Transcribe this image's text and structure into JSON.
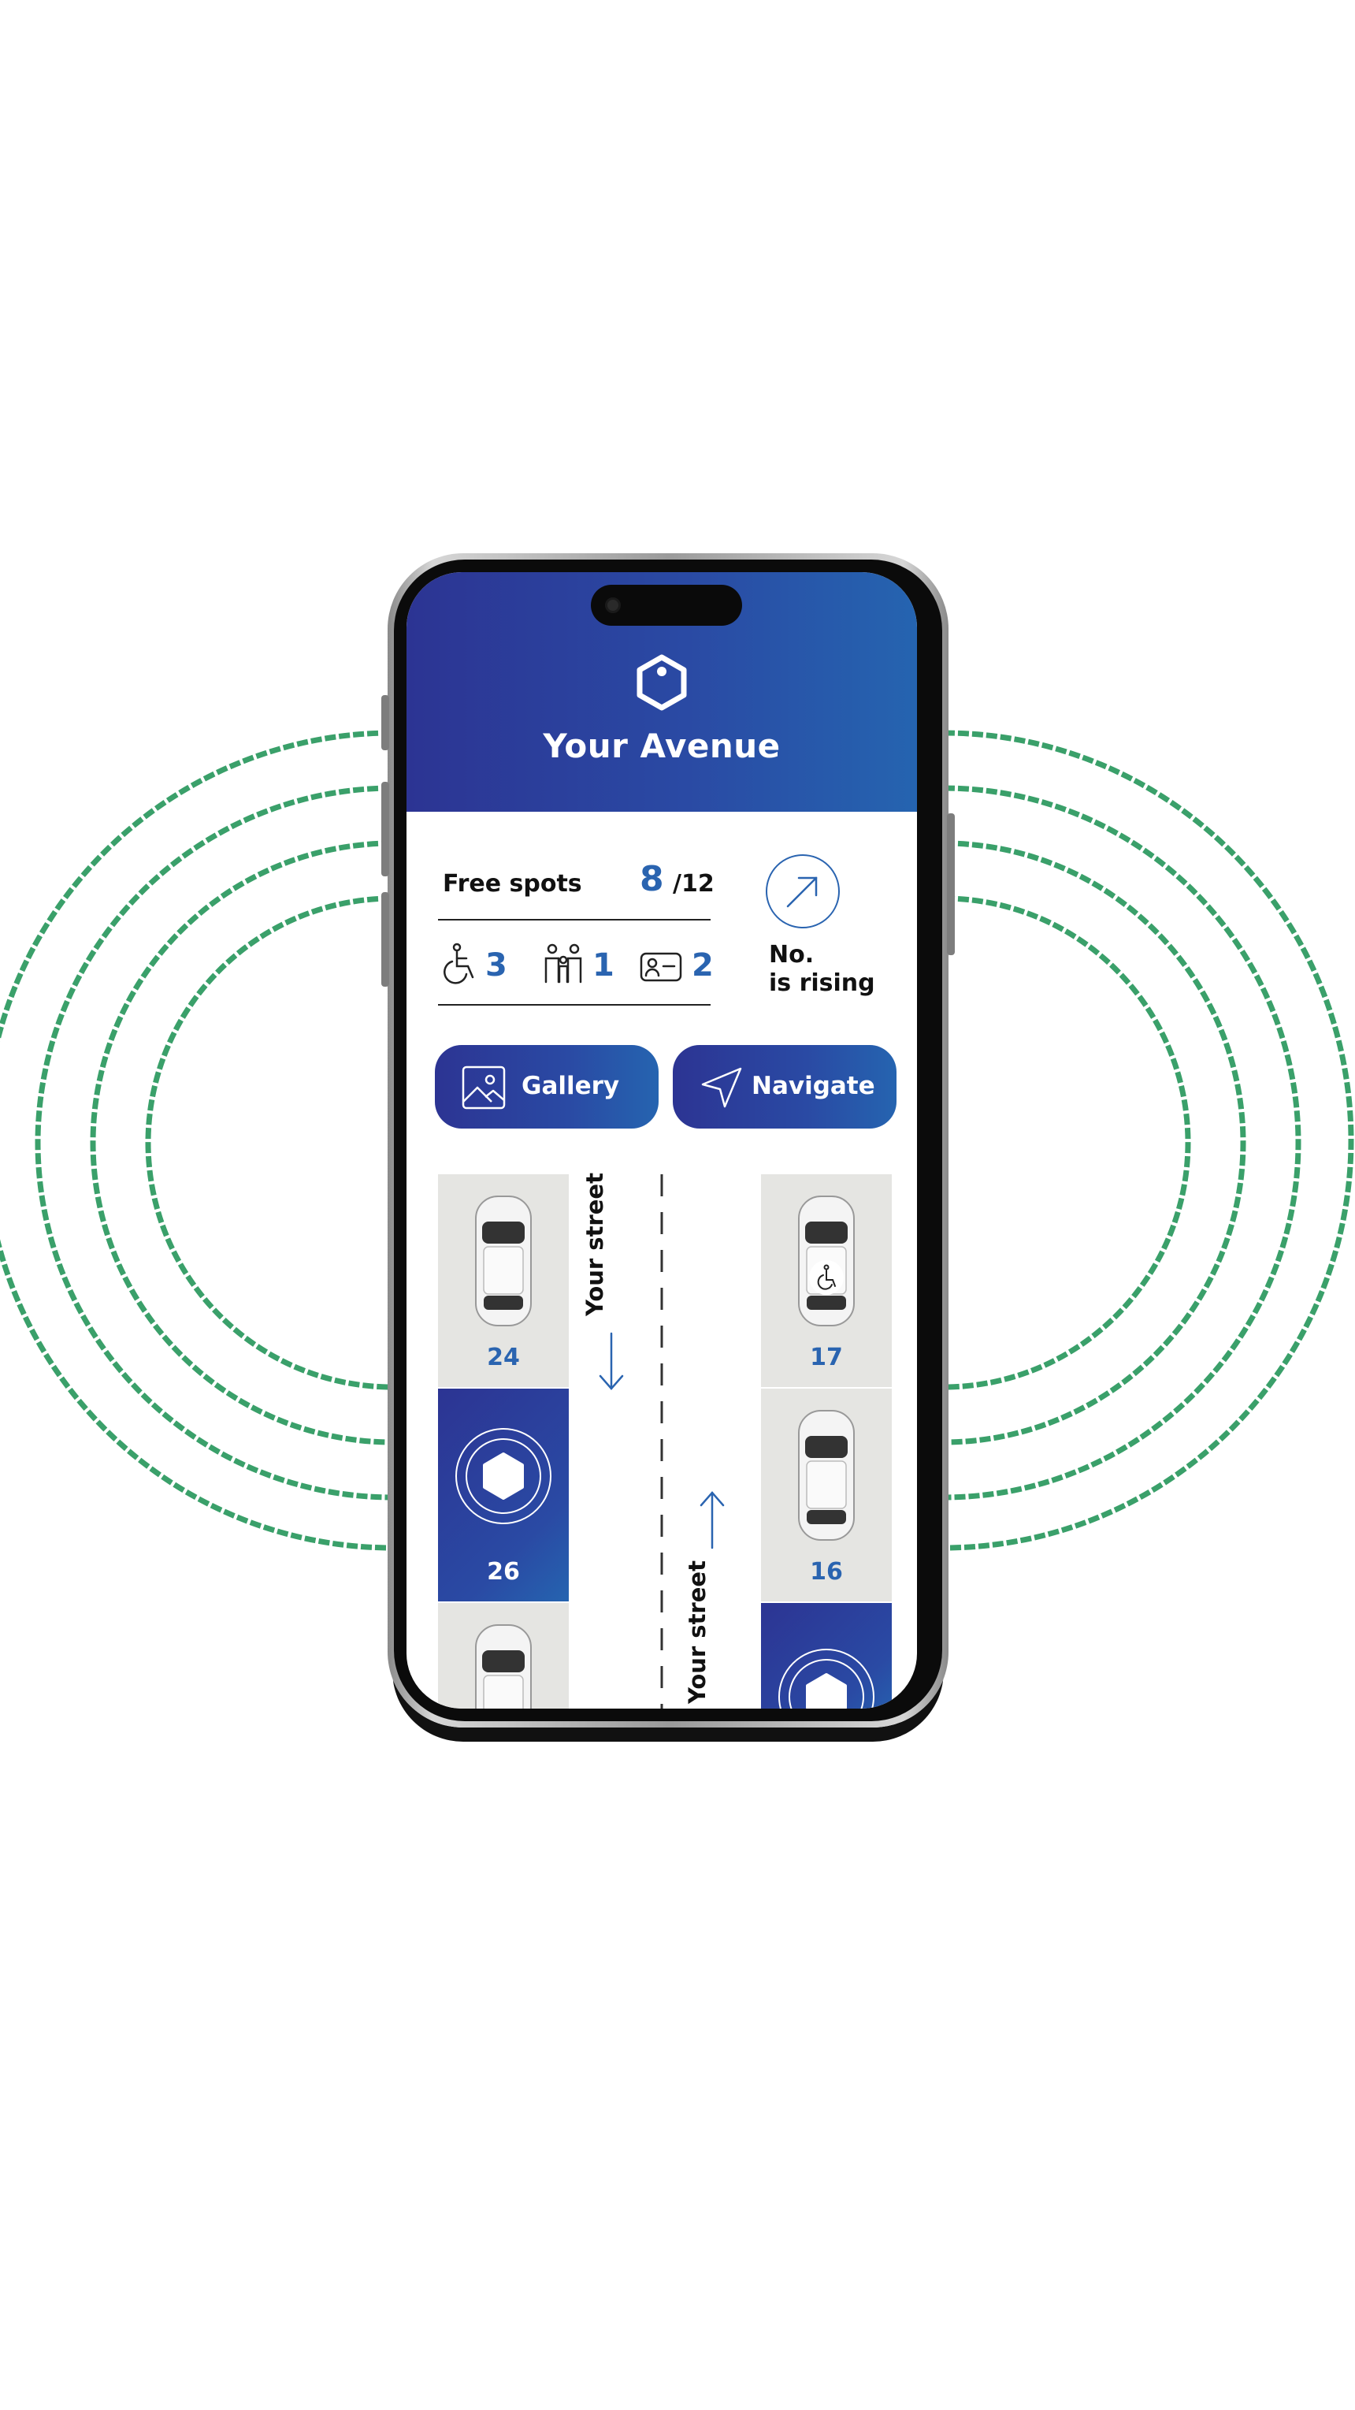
{
  "app": {
    "title": "Your Avenue"
  },
  "stats": {
    "free_label": "Free spots",
    "free_count": "8",
    "free_total": "/12",
    "accessible_count": "3",
    "family_count": "1",
    "permit_count": "2",
    "trend_line1": "No.",
    "trend_line2": "is rising"
  },
  "actions": {
    "gallery_label": "Gallery",
    "navigate_label": "Navigate"
  },
  "street": {
    "label_down": "Your street",
    "label_up": "Your street"
  },
  "spots": {
    "left_top": "24",
    "left_mid": "26",
    "right_top": "17",
    "right_mid": "16"
  },
  "colors": {
    "brand_dark": "#2c3493",
    "brand_light": "#2564b0",
    "accent_number": "#2a64b0",
    "ring_green": "#3aa06a",
    "spot_gray": "#e5e5e2"
  }
}
